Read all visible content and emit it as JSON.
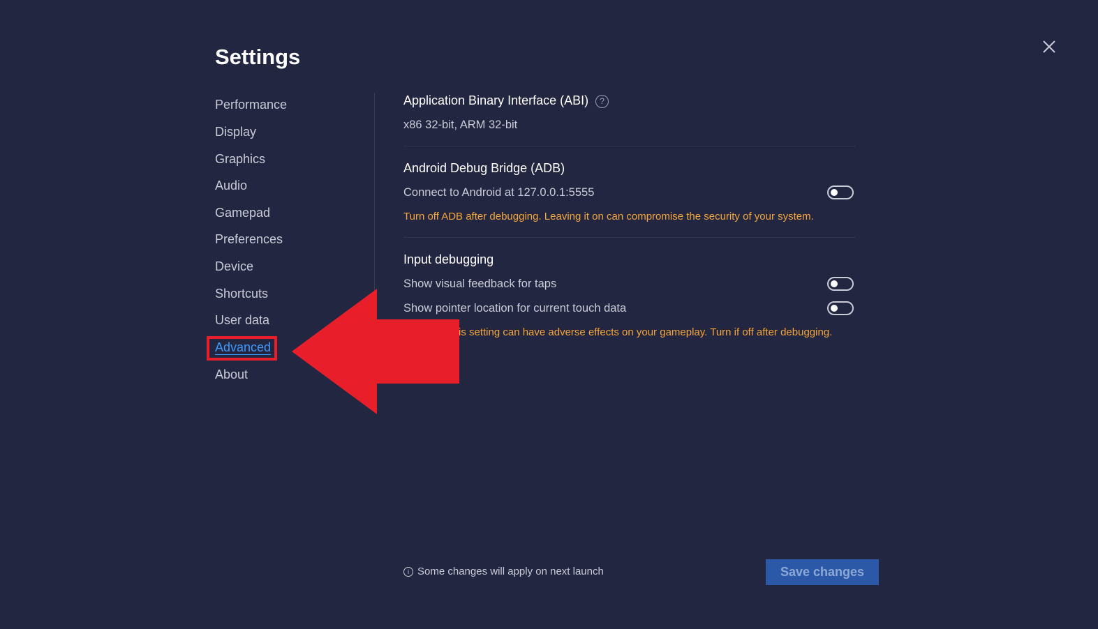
{
  "title": "Settings",
  "sidebar": {
    "items": [
      {
        "label": "Performance"
      },
      {
        "label": "Display"
      },
      {
        "label": "Graphics"
      },
      {
        "label": "Audio"
      },
      {
        "label": "Gamepad"
      },
      {
        "label": "Preferences"
      },
      {
        "label": "Device"
      },
      {
        "label": "Shortcuts"
      },
      {
        "label": "User data"
      },
      {
        "label": "Advanced",
        "active": true
      },
      {
        "label": "About"
      }
    ]
  },
  "abi": {
    "title": "Application Binary Interface (ABI)",
    "help_icon": "?",
    "value": "x86 32-bit, ARM 32-bit"
  },
  "adb": {
    "title": "Android Debug Bridge (ADB)",
    "connect_label": "Connect to Android at 127.0.0.1:5555",
    "connect_enabled": false,
    "warning": "Turn off ADB after debugging. Leaving it on can compromise the security of your system."
  },
  "input_debugging": {
    "title": "Input debugging",
    "visual_feedback_label": "Show visual feedback for taps",
    "visual_feedback_enabled": false,
    "pointer_location_label": "Show pointer location for current touch data",
    "pointer_location_enabled": false,
    "warning": "is setting can have adverse effects on your gameplay. Turn if off after debugging."
  },
  "footer": {
    "note_icon": "i",
    "note": "Some changes will apply on next launch",
    "save_label": "Save changes"
  },
  "colors": {
    "background": "#232640",
    "accent": "#3d9bff",
    "warning": "#f5a63b",
    "annotation": "#e81f2a",
    "save_button": "#2b59a8"
  },
  "icons": {
    "close": "close-icon",
    "help": "help-circle-icon",
    "info": "info-circle-icon",
    "annotation_arrow": "arrow-left-icon"
  }
}
